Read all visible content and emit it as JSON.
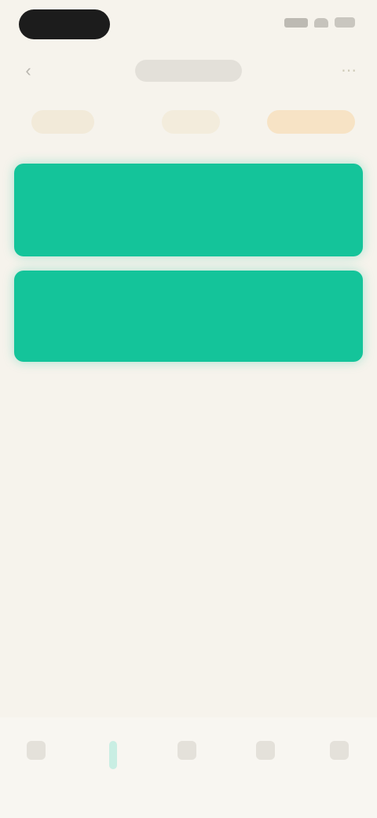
{
  "colors": {
    "background": "#f6f3ec",
    "accent_green": "#14c49a",
    "tab_gold": "#e9b778",
    "status_pill": "#1c1c1c"
  },
  "status_bar": {
    "icons": [
      "cellular-signal-icon",
      "wifi-icon",
      "battery-icon"
    ]
  },
  "header": {
    "title": "",
    "back_icon": "back-arrow-icon",
    "action_icon": "more-icon"
  },
  "tabs": [
    {
      "label": ""
    },
    {
      "label": ""
    },
    {
      "label": "",
      "active": true
    }
  ],
  "cards": [
    {
      "title": "",
      "subtitle": ""
    },
    {
      "title": "",
      "subtitle": ""
    }
  ],
  "tab_bar": {
    "active_index": 1,
    "items": [
      {
        "icon": "home-icon",
        "label": ""
      },
      {
        "icon": "bookmark-icon",
        "label": ""
      },
      {
        "icon": "grid-icon",
        "label": ""
      },
      {
        "icon": "message-icon",
        "label": ""
      },
      {
        "icon": "profile-icon",
        "label": ""
      }
    ]
  }
}
